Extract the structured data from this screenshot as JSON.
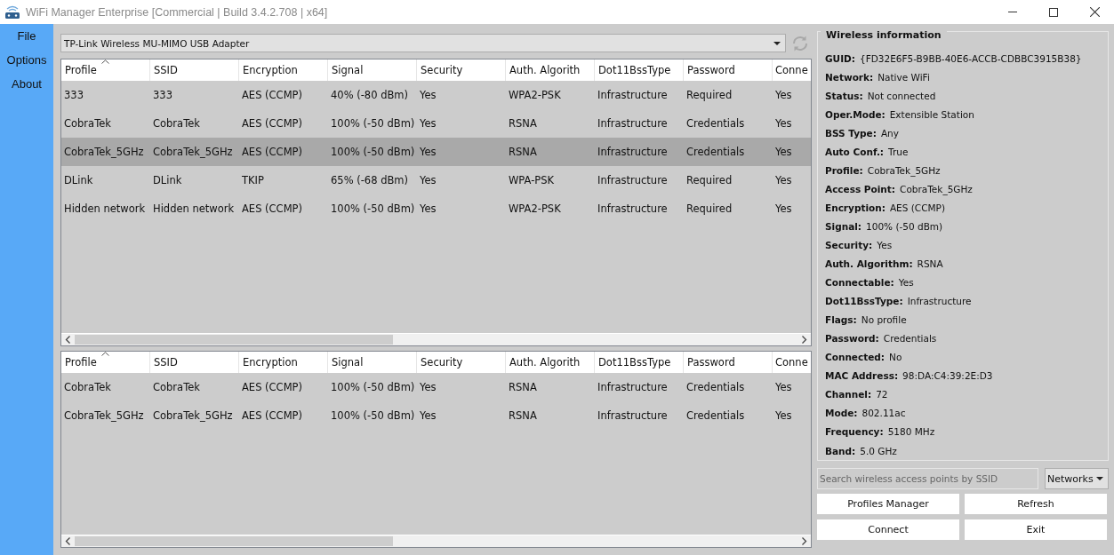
{
  "window": {
    "title": "WiFi Manager Enterprise [Commercial | Build 3.4.2.708 | x64]"
  },
  "menu": [
    "File",
    "Options",
    "About"
  ],
  "adapter": {
    "value": "TP-Link Wireless MU-MIMO USB Adapter"
  },
  "networks_table": {
    "columns": [
      {
        "label": "Profile",
        "sorted": true
      },
      {
        "label": "SSID",
        "sorted": false
      },
      {
        "label": "Encryption",
        "sorted": false
      },
      {
        "label": "Signal",
        "sorted": false
      },
      {
        "label": "Security",
        "sorted": false
      },
      {
        "label": "Auth. Algorith",
        "sorted": false
      },
      {
        "label": "Dot11BssType",
        "sorted": false
      },
      {
        "label": "Password",
        "sorted": false
      },
      {
        "label": "Conne",
        "sorted": false
      }
    ],
    "rows": [
      {
        "cells": [
          "333",
          "333",
          "AES (CCMP)",
          "40% (-80 dBm)",
          "Yes",
          "WPA2-PSK",
          "Infrastructure",
          "Required",
          "Yes"
        ],
        "selected": false
      },
      {
        "cells": [
          "CobraTek",
          "CobraTek",
          "AES (CCMP)",
          "100% (-50 dBm)",
          "Yes",
          "RSNA",
          "Infrastructure",
          "Credentials",
          "Yes"
        ],
        "selected": false
      },
      {
        "cells": [
          "CobraTek_5GHz",
          "CobraTek_5GHz",
          "AES (CCMP)",
          "100% (-50 dBm)",
          "Yes",
          "RSNA",
          "Infrastructure",
          "Credentials",
          "Yes"
        ],
        "selected": true
      },
      {
        "cells": [
          "DLink",
          "DLink",
          "TKIP",
          "65% (-68 dBm)",
          "Yes",
          "WPA-PSK",
          "Infrastructure",
          "Required",
          "Yes"
        ],
        "selected": false
      },
      {
        "cells": [
          "Hidden network",
          "Hidden network",
          "AES (CCMP)",
          "100% (-50 dBm)",
          "Yes",
          "WPA2-PSK",
          "Infrastructure",
          "Required",
          "Yes"
        ],
        "selected": false
      }
    ]
  },
  "profiles_table": {
    "columns": [
      {
        "label": "Profile",
        "sorted": true
      },
      {
        "label": "SSID",
        "sorted": false
      },
      {
        "label": "Encryption",
        "sorted": false
      },
      {
        "label": "Signal",
        "sorted": false
      },
      {
        "label": "Security",
        "sorted": false
      },
      {
        "label": "Auth. Algorith",
        "sorted": false
      },
      {
        "label": "Dot11BssType",
        "sorted": false
      },
      {
        "label": "Password",
        "sorted": false
      },
      {
        "label": "Conne",
        "sorted": false
      }
    ],
    "rows": [
      {
        "cells": [
          "CobraTek",
          "CobraTek",
          "AES (CCMP)",
          "100% (-50 dBm)",
          "Yes",
          "RSNA",
          "Infrastructure",
          "Credentials",
          "Yes"
        ],
        "selected": false
      },
      {
        "cells": [
          "CobraTek_5GHz",
          "CobraTek_5GHz",
          "AES (CCMP)",
          "100% (-50 dBm)",
          "Yes",
          "RSNA",
          "Infrastructure",
          "Credentials",
          "Yes"
        ],
        "selected": false
      }
    ]
  },
  "wireless_info": {
    "title": "Wireless information",
    "fields": [
      {
        "label": "GUID:",
        "value": "{FD32E6F5-B9BB-40E6-ACCB-CDBBC3915B38}"
      },
      {
        "label": "Network:",
        "value": "Native WiFi"
      },
      {
        "label": "Status:",
        "value": "Not connected"
      },
      {
        "label": "Oper.Mode:",
        "value": "Extensible Station"
      },
      {
        "label": "BSS Type:",
        "value": "Any"
      },
      {
        "label": "Auto Conf.:",
        "value": "True"
      },
      {
        "label": "Profile:",
        "value": "CobraTek_5GHz"
      },
      {
        "label": "Access Point:",
        "value": "CobraTek_5GHz"
      },
      {
        "label": "Encryption:",
        "value": "AES (CCMP)"
      },
      {
        "label": "Signal:",
        "value": "100% (-50 dBm)"
      },
      {
        "label": "Security:",
        "value": "Yes"
      },
      {
        "label": "Auth. Algorithm:",
        "value": "RSNA"
      },
      {
        "label": "Connectable:",
        "value": "Yes"
      },
      {
        "label": "Dot11BssType:",
        "value": "Infrastructure"
      },
      {
        "label": "Flags:",
        "value": "No profile"
      },
      {
        "label": "Password:",
        "value": "Credentials"
      },
      {
        "label": "Connected:",
        "value": "No"
      },
      {
        "label": "MAC Address:",
        "value": "98:DA:C4:39:2E:D3"
      },
      {
        "label": "Channel:",
        "value": "72"
      },
      {
        "label": "Mode:",
        "value": "802.11ac"
      },
      {
        "label": "Frequency:",
        "value": "5180 MHz"
      },
      {
        "label": "Band:",
        "value": "5.0 GHz"
      }
    ]
  },
  "search": {
    "placeholder": "Search wireless access points by SSID"
  },
  "filter": {
    "value": "Networks"
  },
  "buttons": [
    "Profiles Manager",
    "Refresh",
    "Connect",
    "Exit"
  ]
}
